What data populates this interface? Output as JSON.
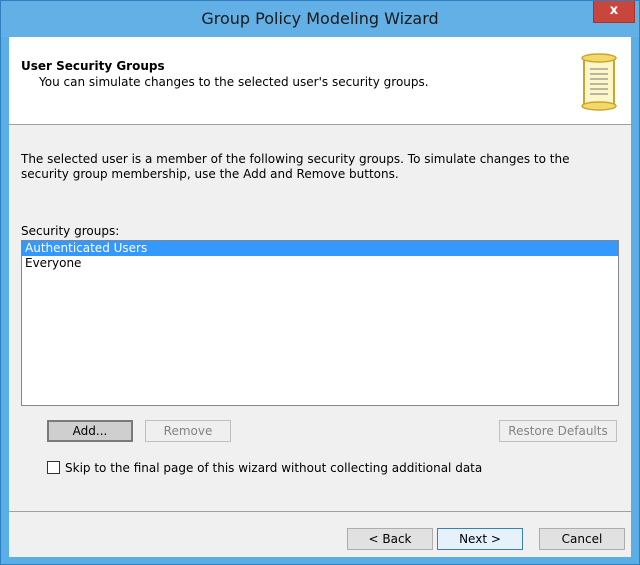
{
  "window": {
    "title": "Group Policy Modeling Wizard",
    "close_label": "x"
  },
  "header": {
    "title": "User Security Groups",
    "subtitle": "You can simulate changes to the selected user's security groups."
  },
  "description": "The selected user is a member of the following security groups. To simulate changes to the security group membership, use the Add and Remove buttons.",
  "groups": {
    "label": "Security groups:",
    "items": [
      "Authenticated Users",
      "Everyone"
    ],
    "selected": "Authenticated Users"
  },
  "buttons": {
    "add": "Add...",
    "remove": "Remove",
    "restore": "Restore Defaults",
    "back": "< Back",
    "next": "Next >",
    "cancel": "Cancel"
  },
  "skip_checkbox": {
    "label": "Skip to the final page of this wizard without collecting additional data",
    "checked": false
  },
  "colors": {
    "titlebar": "#62b0e6",
    "selection": "#3399ff",
    "close": "#c8463c"
  }
}
